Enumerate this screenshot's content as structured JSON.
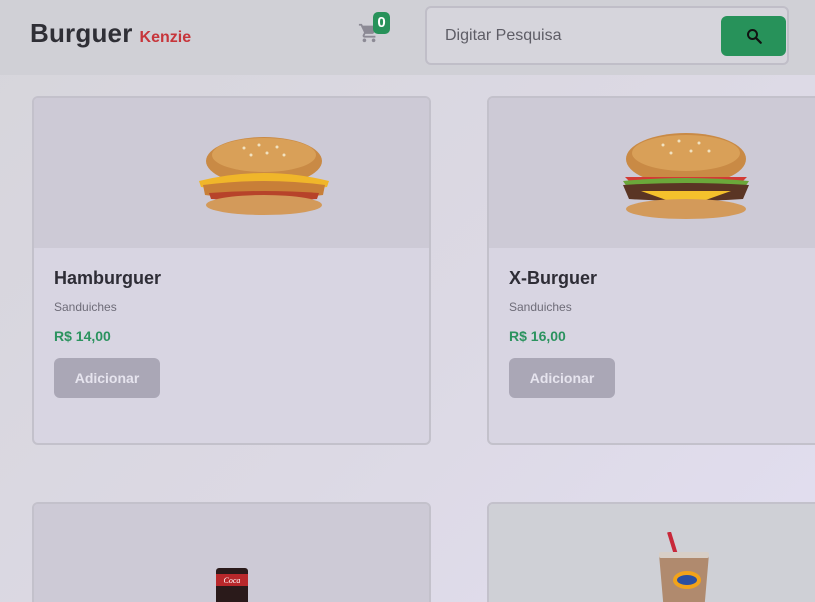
{
  "header": {
    "logo_main": "Burguer",
    "logo_sub": "Kenzie",
    "cart_count": "0",
    "search": {
      "placeholder": "Digitar Pesquisa",
      "icon": "search-icon"
    }
  },
  "products": [
    {
      "name": "Hamburguer",
      "category": "Sanduiches",
      "price": "R$ 14,00",
      "button": "Adicionar"
    },
    {
      "name": "X-Burguer",
      "category": "Sanduiches",
      "price": "R$ 16,00",
      "button": "Adicionar"
    }
  ],
  "colors": {
    "brand_green": "#27925a",
    "brand_red": "#c7353b",
    "button_disabled": "#aaa7b6"
  }
}
